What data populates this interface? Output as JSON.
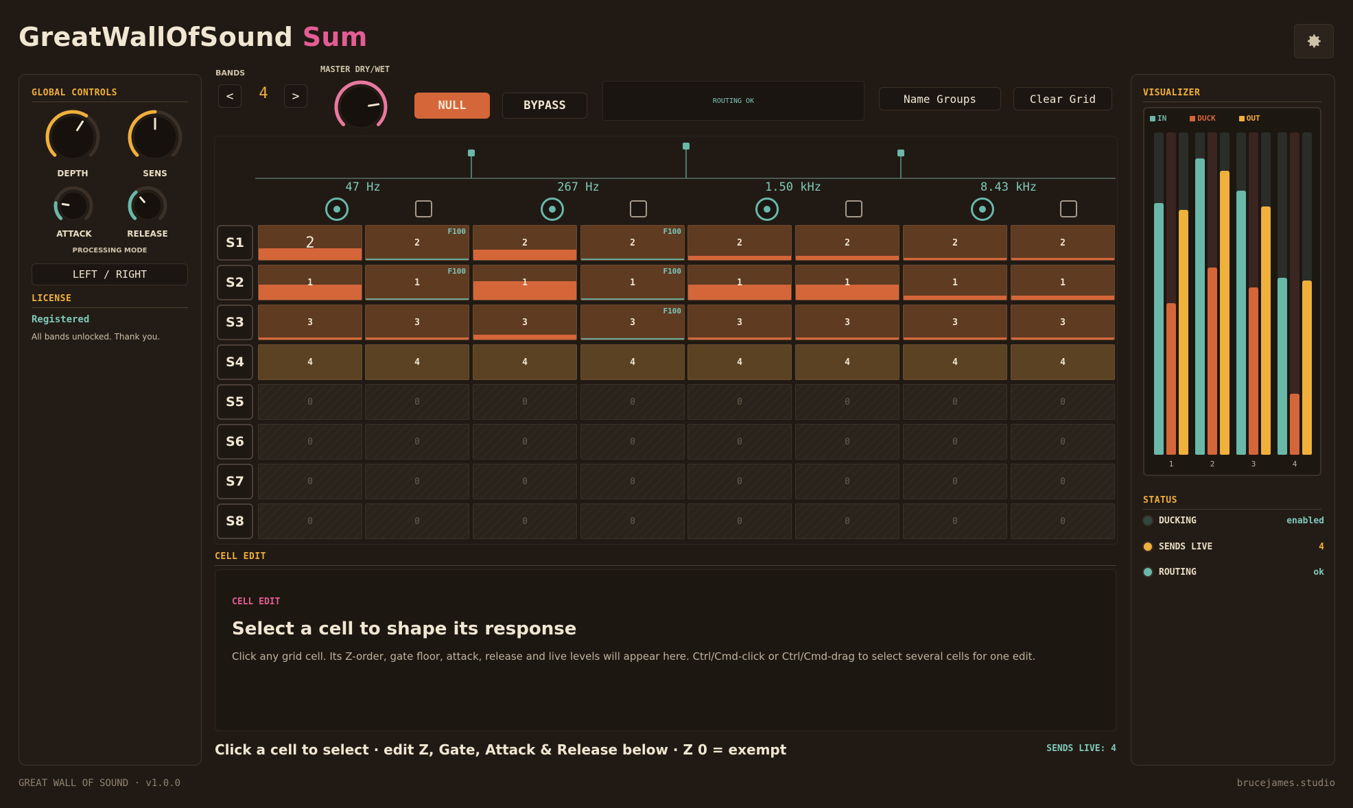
{
  "app": {
    "title_main": "GreatWallOfSound",
    "title_accent": "Sum"
  },
  "settings_icon": "gear-icon",
  "global_controls": {
    "title": "GLOBAL CONTROLS",
    "knobs": [
      {
        "label": "DEPTH",
        "value": 0.62,
        "color": "#f0b03c"
      },
      {
        "label": "SENS",
        "value": 0.5,
        "color": "#f0b03c"
      },
      {
        "label": "ATTACK",
        "value": 0.2,
        "color": "#6ab8aa"
      },
      {
        "label": "RELEASE",
        "value": 0.35,
        "color": "#6ab8aa"
      }
    ],
    "processing_mode_label": "PROCESSING MODE",
    "processing_mode_value": "LEFT / RIGHT"
  },
  "license": {
    "title": "LICENSE",
    "status": "Registered",
    "message": "All bands unlocked. Thank you."
  },
  "toolbar": {
    "bands_label": "BANDS",
    "bands_prev": "<",
    "bands_value": "4",
    "bands_next": ">",
    "master_label": "MASTER DRY/WET",
    "master_value": 0.8,
    "null_label": "NULL",
    "bypass_label": "BYPASS",
    "routing_status": "ROUTING OK",
    "name_groups_label": "Name Groups",
    "clear_grid_label": "Clear Grid"
  },
  "bands": [
    {
      "freq": "47 Hz"
    },
    {
      "freq": "267 Hz"
    },
    {
      "freq": "1.50 kHz"
    },
    {
      "freq": "8.43 kHz"
    }
  ],
  "grid": {
    "rows": [
      {
        "label": "S1",
        "cells": [
          {
            "value": "2",
            "fill": 0.35,
            "big": true
          },
          {
            "value": "2",
            "tag": "F100",
            "uline": true
          },
          {
            "value": "2",
            "fill": 0.3
          },
          {
            "value": "2",
            "tag": "F100",
            "uline": true
          },
          {
            "value": "2",
            "fill": 0.12
          },
          {
            "value": "2",
            "fill": 0.12
          },
          {
            "value": "2",
            "fill": 0.07
          },
          {
            "value": "2",
            "fill": 0.07
          }
        ]
      },
      {
        "label": "S2",
        "cells": [
          {
            "value": "1",
            "fill": 0.45
          },
          {
            "value": "1",
            "tag": "F100",
            "uline": true
          },
          {
            "value": "1",
            "fill": 0.55
          },
          {
            "value": "1",
            "tag": "F100",
            "uline": true
          },
          {
            "value": "1",
            "fill": 0.45
          },
          {
            "value": "1",
            "fill": 0.45
          },
          {
            "value": "1",
            "fill": 0.12
          },
          {
            "value": "1",
            "fill": 0.12
          }
        ]
      },
      {
        "label": "S3",
        "cells": [
          {
            "value": "3",
            "fill": 0.07
          },
          {
            "value": "3",
            "fill": 0.07
          },
          {
            "value": "3",
            "fill": 0.15
          },
          {
            "value": "3",
            "tag": "F100",
            "uline": true
          },
          {
            "value": "3",
            "fill": 0.07
          },
          {
            "value": "3",
            "fill": 0.07
          },
          {
            "value": "3",
            "fill": 0.07
          },
          {
            "value": "3",
            "fill": 0.07
          }
        ]
      },
      {
        "label": "S4",
        "cells": [
          {
            "value": "4"
          },
          {
            "value": "4"
          },
          {
            "value": "4"
          },
          {
            "value": "4"
          },
          {
            "value": "4"
          },
          {
            "value": "4"
          },
          {
            "value": "4"
          },
          {
            "value": "4"
          }
        ]
      },
      {
        "label": "S5",
        "cells": [
          {
            "value": "0"
          },
          {
            "value": "0"
          },
          {
            "value": "0"
          },
          {
            "value": "0"
          },
          {
            "value": "0"
          },
          {
            "value": "0"
          },
          {
            "value": "0"
          },
          {
            "value": "0"
          }
        ]
      },
      {
        "label": "S6",
        "cells": [
          {
            "value": "0"
          },
          {
            "value": "0"
          },
          {
            "value": "0"
          },
          {
            "value": "0"
          },
          {
            "value": "0"
          },
          {
            "value": "0"
          },
          {
            "value": "0"
          },
          {
            "value": "0"
          }
        ]
      },
      {
        "label": "S7",
        "cells": [
          {
            "value": "0"
          },
          {
            "value": "0"
          },
          {
            "value": "0"
          },
          {
            "value": "0"
          },
          {
            "value": "0"
          },
          {
            "value": "0"
          },
          {
            "value": "0"
          },
          {
            "value": "0"
          }
        ]
      },
      {
        "label": "S8",
        "cells": [
          {
            "value": "0"
          },
          {
            "value": "0"
          },
          {
            "value": "0"
          },
          {
            "value": "0"
          },
          {
            "value": "0"
          },
          {
            "value": "0"
          },
          {
            "value": "0"
          },
          {
            "value": "0"
          }
        ]
      }
    ]
  },
  "cell_edit": {
    "section_title": "CELL EDIT",
    "inner_label": "CELL EDIT",
    "heading": "Select a cell to shape its response",
    "description": "Click any grid cell. Its Z-order, gate floor, attack, release and live levels will appear here. Ctrl/Cmd-click or Ctrl/Cmd-drag to select several cells for one edit."
  },
  "hint": {
    "text": "Click a cell to select · edit Z, Gate, Attack & Release below · Z 0 = exempt",
    "sends_live": "SENDS LIVE: 4"
  },
  "visualizer": {
    "title": "VISUALIZER",
    "legend": [
      {
        "label": "IN",
        "color": "#6ab8aa"
      },
      {
        "label": "DUCK",
        "color": "#d4663a"
      },
      {
        "label": "OUT",
        "color": "#f0b03c"
      }
    ],
    "bands": [
      {
        "label": "1",
        "in": 0.78,
        "duck": 0.47,
        "out": 0.76
      },
      {
        "label": "2",
        "in": 0.92,
        "duck": 0.58,
        "out": 0.88
      },
      {
        "label": "3",
        "in": 0.82,
        "duck": 0.52,
        "out": 0.77
      },
      {
        "label": "4",
        "in": 0.55,
        "duck": 0.19,
        "out": 0.54
      }
    ]
  },
  "status": {
    "title": "STATUS",
    "rows": [
      {
        "label": "DUCKING",
        "value": "enabled",
        "color": "#2e4a40"
      },
      {
        "label": "SENDS LIVE",
        "value": "4",
        "color": "#f0b03c"
      },
      {
        "label": "ROUTING",
        "value": "ok",
        "color": "#6ab8aa"
      }
    ]
  },
  "footer": {
    "left": "GREAT WALL OF SOUND · v1.0.0",
    "right": "brucejames.studio"
  }
}
